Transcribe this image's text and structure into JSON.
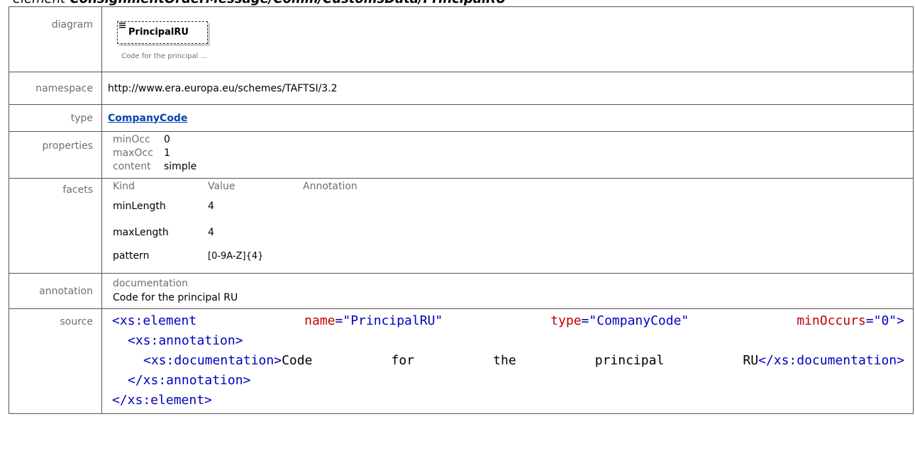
{
  "page_heading": {
    "prefix": "element",
    "path": "ConsignmentOrderMessage/Comm/CustomsData/PrincipalRU"
  },
  "rows": {
    "diagram": {
      "label": "diagram",
      "element_name": "PrincipalRU",
      "note": "Code for the principal ..."
    },
    "namespace": {
      "label": "namespace",
      "value": "http://www.era.europa.eu/schemes/TAFTSI/3.2"
    },
    "type": {
      "label": "type",
      "value": "CompanyCode"
    },
    "properties": {
      "label": "properties",
      "items": [
        {
          "key": "minOcc",
          "value": "0"
        },
        {
          "key": "maxOcc",
          "value": "1"
        },
        {
          "key": "content",
          "value": "simple"
        }
      ]
    },
    "facets": {
      "label": "facets",
      "headers": [
        "Kind",
        "Value",
        "Annotation"
      ],
      "items": [
        {
          "kind": "minLength",
          "value": "4",
          "annotation": ""
        },
        {
          "kind": "maxLength",
          "value": "4",
          "annotation": ""
        },
        {
          "kind": "pattern",
          "value": "[0-9A-Z]{4}",
          "annotation": ""
        }
      ]
    },
    "annotation": {
      "label": "annotation",
      "key": "documentation",
      "value": "Code for the principal RU"
    },
    "source": {
      "label": "source",
      "line1": {
        "tag_open": "<xs:element",
        "attr1": "name",
        "eq1": "=",
        "val1": "\"PrincipalRU\"",
        "attr2": "type",
        "eq2": "=",
        "val2": "\"CompanyCode\"",
        "attr3": "minOccurs",
        "eq3": "=",
        "val3": "\"0\"",
        "close": ">"
      },
      "line2": "<xs:annotation>",
      "line3": {
        "tag_open": "<xs:documentation>",
        "words": [
          "Code",
          "for",
          "the",
          "principal",
          "RU"
        ],
        "tag_close": "</xs:documentation>"
      },
      "line4": "</xs:annotation>",
      "line5": "</xs:element>"
    }
  },
  "colors": {
    "tag": "#0000c0",
    "attribute": "#c00000",
    "link": "#0645ad",
    "label_gray": "#6f6f6f"
  }
}
